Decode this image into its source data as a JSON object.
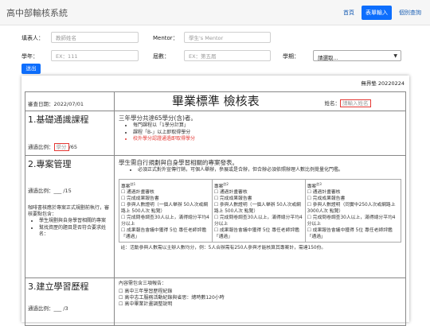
{
  "topbar": {
    "brand": "高中部輸核系統",
    "nav": [
      "首頁",
      "表單輸入",
      "個別查詢"
    ],
    "active_index": 1
  },
  "form": {
    "filler_label": "填表人：",
    "filler_placeholder": "教師姓名",
    "mentor_label": "Mentor：",
    "mentor_placeholder": "學生's Mentor",
    "year_label": "學年：",
    "year_placeholder": "EX：111",
    "cohort_label": "屆數：",
    "cohort_placeholder": "EX：第五屆",
    "term_label": "學期：",
    "term_value": "請選取...",
    "submit_label": "送出"
  },
  "doc": {
    "doc_id": "無界墊 20220224",
    "review_date": "審查日期：2022/07/01",
    "title": "畢業標準 檢核表",
    "name_label": "姓名：",
    "name_placeholder": "請輸入姓名",
    "sec1": {
      "title": "1.基礎通識課程",
      "ratio_label": "通過比例：",
      "ratio_value": "學分",
      "ratio_total": "/65",
      "intro": "三年學分共達65學分(含)者。",
      "bullets": [
        "每門課程以「1學分計算」",
        "課程「B-」以上即取得學分"
      ],
      "red_bullet": "校外學分認證通過即取得學分"
    },
    "sec2": {
      "title": "2.專案管理",
      "ratio": "通過比例：___ /15",
      "desc": "咖啡書核應於專案正式規劃前執行，審核要點包含：",
      "bullets": [
        "學生規劃與自身學習相關的專案",
        "幫找資歷的題目是否符合要求姓名："
      ],
      "intro": "學生需自行規劃與自身學習相關的專案發表。",
      "sub_bullet": "必須正式對外宣傳行銷，可個人舉辦，參展或是合辦，但合辦必須依照辦理人數比例覺量化門檻。",
      "cols": [
        {
          "head": "專案",
          "sup": "註1",
          "items": [
            "通過計畫審核",
            "完成成果報告書",
            "參與人數證明（一個人舉辦 50人次或網路上 500人次 點覽）",
            "完成問卷調查30人以上，滿得總分平均4分以上",
            "成果報告會議中獲得 5位 專任老師評鑑「通過」"
          ]
        },
        {
          "head": "專案",
          "sup": "註2",
          "items": [
            "通過計畫審核",
            "完成成果報告書",
            "參與人數證明（一個人舉辦 50人次或網路上 500人次 點覽）",
            "完成問卷調查30人以上，滿得總分平均4分以上",
            "成果報告會議中獲得 5位 專任老師評鑑「通過」"
          ]
        },
        {
          "head": "專案",
          "sup": "註3",
          "items": [
            "通過計畫審核",
            "完成成果報告書",
            "參與人數證明（同實中250人次或網路上3000人次 點覽）",
            "完成問卷調查30人以上，滿得總分平均4分以上",
            "成果報告會議中獲得 5位 專任老師評鑑「通過」"
          ]
        }
      ],
      "note": "註：活動參與人數需以主辦人數均分，例：5人合辦需有250人參與才能核算其專案計，需達150份。"
    },
    "sec3": {
      "title": "3.建立學習歷程",
      "ratio": "通過比例：___ /3",
      "intro": "內容需包含三項報告：",
      "items": [
        "高中三年學習歷程紀錄",
        "高中志工服務活動紀錄與省思：總時數120小時",
        "高中畢業計畫調整說明"
      ]
    }
  }
}
